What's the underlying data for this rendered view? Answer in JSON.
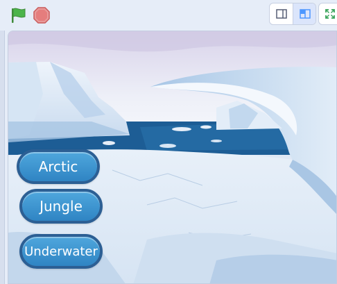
{
  "toolbar": {
    "green_flag_icon": "green-flag-icon",
    "stop_icon": "stop-sign-icon",
    "layout_small_icon": "small-stage-icon",
    "layout_normal_icon": "normal-stage-icon",
    "fullscreen_icon": "fullscreen-icon"
  },
  "stage": {
    "backdrop": "arctic-ice-landscape",
    "buttons": [
      {
        "label": "Arctic"
      },
      {
        "label": "Jungle"
      },
      {
        "label": "Underwater"
      }
    ]
  },
  "colors": {
    "flag_green": "#4cb44a",
    "stop_red": "#e26b6b",
    "button_blue": "#3f97d3",
    "button_border": "#2c5f94",
    "water": "#1d5d95"
  }
}
